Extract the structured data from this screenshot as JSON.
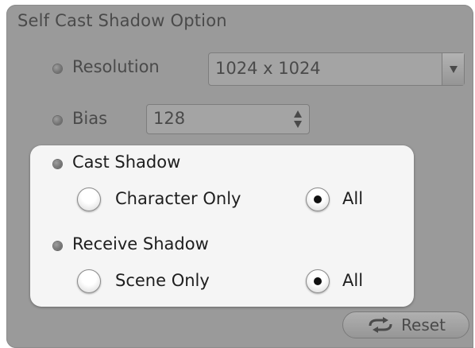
{
  "panel": {
    "title": "Self Cast Shadow Option"
  },
  "resolution": {
    "label": "Resolution",
    "value": "1024 x 1024"
  },
  "bias": {
    "label": "Bias",
    "value": "128"
  },
  "cast_shadow": {
    "label": "Cast Shadow",
    "options": [
      "Character Only",
      "All"
    ],
    "selected": "All"
  },
  "receive_shadow": {
    "label": "Receive Shadow",
    "options": [
      "Scene Only",
      "All"
    ],
    "selected": "All"
  },
  "reset": {
    "label": "Reset",
    "icon": "refresh-arrows-icon"
  }
}
